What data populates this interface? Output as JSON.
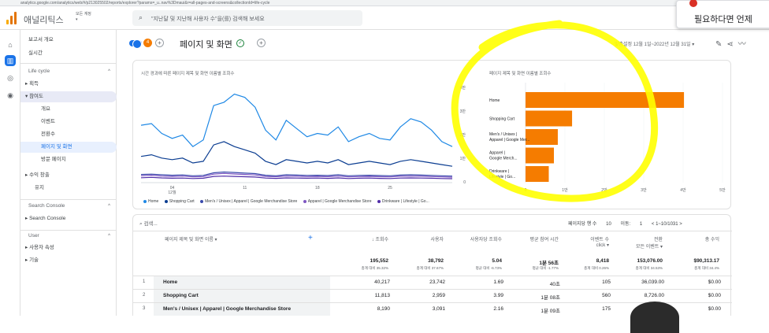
{
  "browser": {
    "url": "analytics.google.com/analytics/web/#/p213025502/reports/explorer?params=_u..nav%3Dmaui&r=all-pages-and-screens&collectionId=life-cycle"
  },
  "app": {
    "name": "애널리틱스",
    "account_line1": "모든 계정",
    "account_line2": "▾"
  },
  "search": {
    "placeholder": "\"지난달 및 지난해 사용자 수\"을(를) 검색해 보세요"
  },
  "toast": {
    "text": "필요하다면 언제"
  },
  "sidebar": {
    "items": [
      {
        "label": "보고서 개요"
      },
      {
        "label": "실시간"
      },
      {
        "label": "Life cycle",
        "chev": "^"
      },
      {
        "label": "▸  획득"
      },
      {
        "label": "▾  참여도"
      },
      {
        "label": "개요"
      },
      {
        "label": "이벤트"
      },
      {
        "label": "전환수"
      },
      {
        "label": "페이지 및 화면"
      },
      {
        "label": "방문 페이지"
      },
      {
        "label": "▸  수익 창출"
      },
      {
        "label": "유지"
      },
      {
        "label": "Search Console",
        "chev": "^"
      },
      {
        "label": "▸  Search Console"
      },
      {
        "label": "User",
        "chev": "^"
      },
      {
        "label": "▸  사용자 속성"
      },
      {
        "label": "▸  기술"
      }
    ]
  },
  "header": {
    "title": "페이지 및 화면",
    "badge": "4",
    "compare_label": "맞춤설정  12월 1일~2022년 12월 31일  ▾"
  },
  "line_chart": {
    "title": "시간 경과에 따른 페이지 제목 및 화면 이름별 조회수",
    "x_labels": [
      "04\n12월",
      "11",
      "18",
      "25"
    ]
  },
  "bar_chart": {
    "title": "페이지 제목 및 화면 이름별 조회수"
  },
  "legend": [
    "Home",
    "Shopping Cart",
    "Men's / Unisex | Apparel | Google Merchandise Store",
    "Apparel | Google Merchandise Store",
    "Drinkware | Lifestyle | Go..."
  ],
  "legend_colors": [
    "#1e88e5",
    "#0b3d91",
    "#3949ab",
    "#7e57c2",
    "#512da8"
  ],
  "chart_data": [
    {
      "type": "line",
      "title": "시간 경과에 따른 페이지 제목 및 화면 이름별 조회수",
      "x": [
        "12-01",
        "12-02",
        "12-03",
        "12-04",
        "12-05",
        "12-06",
        "12-07",
        "12-08",
        "12-09",
        "12-10",
        "12-11",
        "12-12",
        "12-13",
        "12-14",
        "12-15",
        "12-16",
        "12-17",
        "12-18",
        "12-19",
        "12-20",
        "12-21",
        "12-22",
        "12-23",
        "12-24",
        "12-25",
        "12-26",
        "12-27",
        "12-28",
        "12-29",
        "12-30",
        "12-31"
      ],
      "x_tick_labels": [
        "04 12월",
        "11",
        "18",
        "25"
      ],
      "series": [
        {
          "name": "Home",
          "color": "#1e88e5",
          "values": [
            3500,
            3600,
            3000,
            2700,
            2900,
            2200,
            2600,
            4700,
            4900,
            5400,
            5200,
            4600,
            3200,
            2600,
            3800,
            3300,
            2800,
            3000,
            2900,
            3400,
            2500,
            2800,
            3000,
            2700,
            2600,
            3400,
            3900,
            3700,
            3200,
            2500,
            2200
          ]
        },
        {
          "name": "Shopping Cart",
          "color": "#0b3d91",
          "values": [
            1600,
            1700,
            1500,
            1400,
            1500,
            1200,
            1300,
            2300,
            2500,
            2200,
            2000,
            1800,
            1300,
            1100,
            1400,
            1300,
            1200,
            1300,
            1200,
            1400,
            1100,
            1200,
            1300,
            1200,
            1100,
            1300,
            1400,
            1300,
            1200,
            1100,
            1000
          ]
        },
        {
          "name": "Men's / Unisex | Apparel | Google Merchandise Store",
          "color": "#3949ab",
          "values": [
            500,
            520,
            480,
            450,
            470,
            420,
            440,
            600,
            650,
            620,
            580,
            550,
            450,
            420,
            480,
            460,
            440,
            450,
            430,
            480,
            420,
            440,
            450,
            430,
            420,
            460,
            480,
            460,
            440,
            420,
            400
          ]
        },
        {
          "name": "Apparel | Google Merchandise Store",
          "color": "#7e57c2",
          "values": [
            420,
            450,
            400,
            380,
            400,
            350,
            370,
            520,
            560,
            530,
            500,
            470,
            380,
            360,
            400,
            390,
            370,
            380,
            360,
            400,
            350,
            370,
            380,
            360,
            350,
            390,
            400,
            390,
            370,
            350,
            330
          ]
        },
        {
          "name": "Drinkware | Lifestyle | Go...",
          "color": "#512da8",
          "values": [
            300,
            320,
            290,
            270,
            280,
            250,
            270,
            380,
            400,
            380,
            360,
            340,
            280,
            260,
            290,
            280,
            270,
            280,
            260,
            290,
            250,
            270,
            280,
            260,
            250,
            280,
            290,
            280,
            270,
            250,
            240
          ]
        }
      ]
    },
    {
      "type": "bar",
      "title": "페이지 제목 및 화면 이름별 조회수",
      "orientation": "horizontal",
      "categories": [
        "Home",
        "Shopping Cart",
        "Men's / Unisex | Apparel | Google Merch...",
        "Apparel | Google Merch...",
        "Drinkware | Lifestyle | Go..."
      ],
      "values": [
        40217,
        11813,
        8190,
        7200,
        5900
      ],
      "color": "#f57c00",
      "x_ticks": [
        "0",
        "1만",
        "2만",
        "3만",
        "4만",
        "5만"
      ],
      "xlim": [
        0,
        50000
      ]
    }
  ],
  "table": {
    "search_placeholder": "검색...",
    "rows_per_page_label": "페이지당 행 수",
    "rows_per_page": "10",
    "goto_label": "이동:",
    "goto_value": "1",
    "page_range": "< 1~10/1031 >",
    "dim_header": "페이지 제목 및 화면 이름",
    "headers": [
      "↓ 조회수",
      "사용자",
      "사용자당 조회수",
      "평균 참여 시간",
      "이벤트 수",
      "전환",
      "총 수익"
    ],
    "header_subs": [
      "",
      "",
      "",
      "",
      "click ▾",
      "모든 이벤트 ▾",
      ""
    ],
    "totals": [
      "195,552",
      "38,792",
      "5.04",
      "1분 56초",
      "8,418",
      "153,076.00",
      "$90,313.17"
    ],
    "totals_sub": [
      "총계 대비 35.32%",
      "총계 대비 37.67%",
      "평균 대비 -6.73%",
      "평균 대비 -1.77%",
      "총계 대비 0.26%",
      "총계 대비 34.53%",
      "총계 대비 34.4%"
    ],
    "rows": [
      {
        "n": "1",
        "name": "Home",
        "cells": [
          "40,217",
          "23,742",
          "1.69",
          "40초",
          "105",
          "36,039.00",
          "$0.00"
        ]
      },
      {
        "n": "2",
        "name": "Shopping Cart",
        "cells": [
          "11,813",
          "2,959",
          "3.99",
          "1분 08초",
          "560",
          "8,726.00",
          "$0.00"
        ]
      },
      {
        "n": "3",
        "name": "Men's / Unisex | Apparel | Google Merchandise Store",
        "cells": [
          "8,190",
          "3,091",
          "2.16",
          "1분 09초",
          "175",
          "",
          "$0.00"
        ]
      }
    ]
  }
}
